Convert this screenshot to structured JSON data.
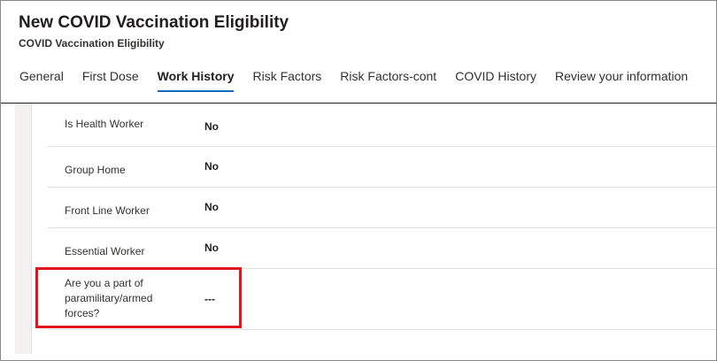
{
  "form": {
    "title": "New COVID Vaccination Eligibility",
    "subtitle": "COVID Vaccination Eligibility"
  },
  "tabs": [
    {
      "label": "General"
    },
    {
      "label": "First Dose"
    },
    {
      "label": "Work History",
      "active": true
    },
    {
      "label": "Risk Factors"
    },
    {
      "label": "Risk Factors-cont"
    },
    {
      "label": "COVID History"
    },
    {
      "label": "Review your information"
    }
  ],
  "fields": [
    {
      "label": "Is Health Worker",
      "value": "No"
    },
    {
      "label": "Group Home",
      "value": "No"
    },
    {
      "label": "Front Line Worker",
      "value": "No"
    },
    {
      "label": "Essential Worker",
      "value": "No"
    },
    {
      "label": "Are you a part of paramilitary/armed forces?",
      "value": "---"
    }
  ],
  "colors": {
    "active_tab_underline": "#0f6cbd",
    "highlight_border": "#e0161d"
  }
}
